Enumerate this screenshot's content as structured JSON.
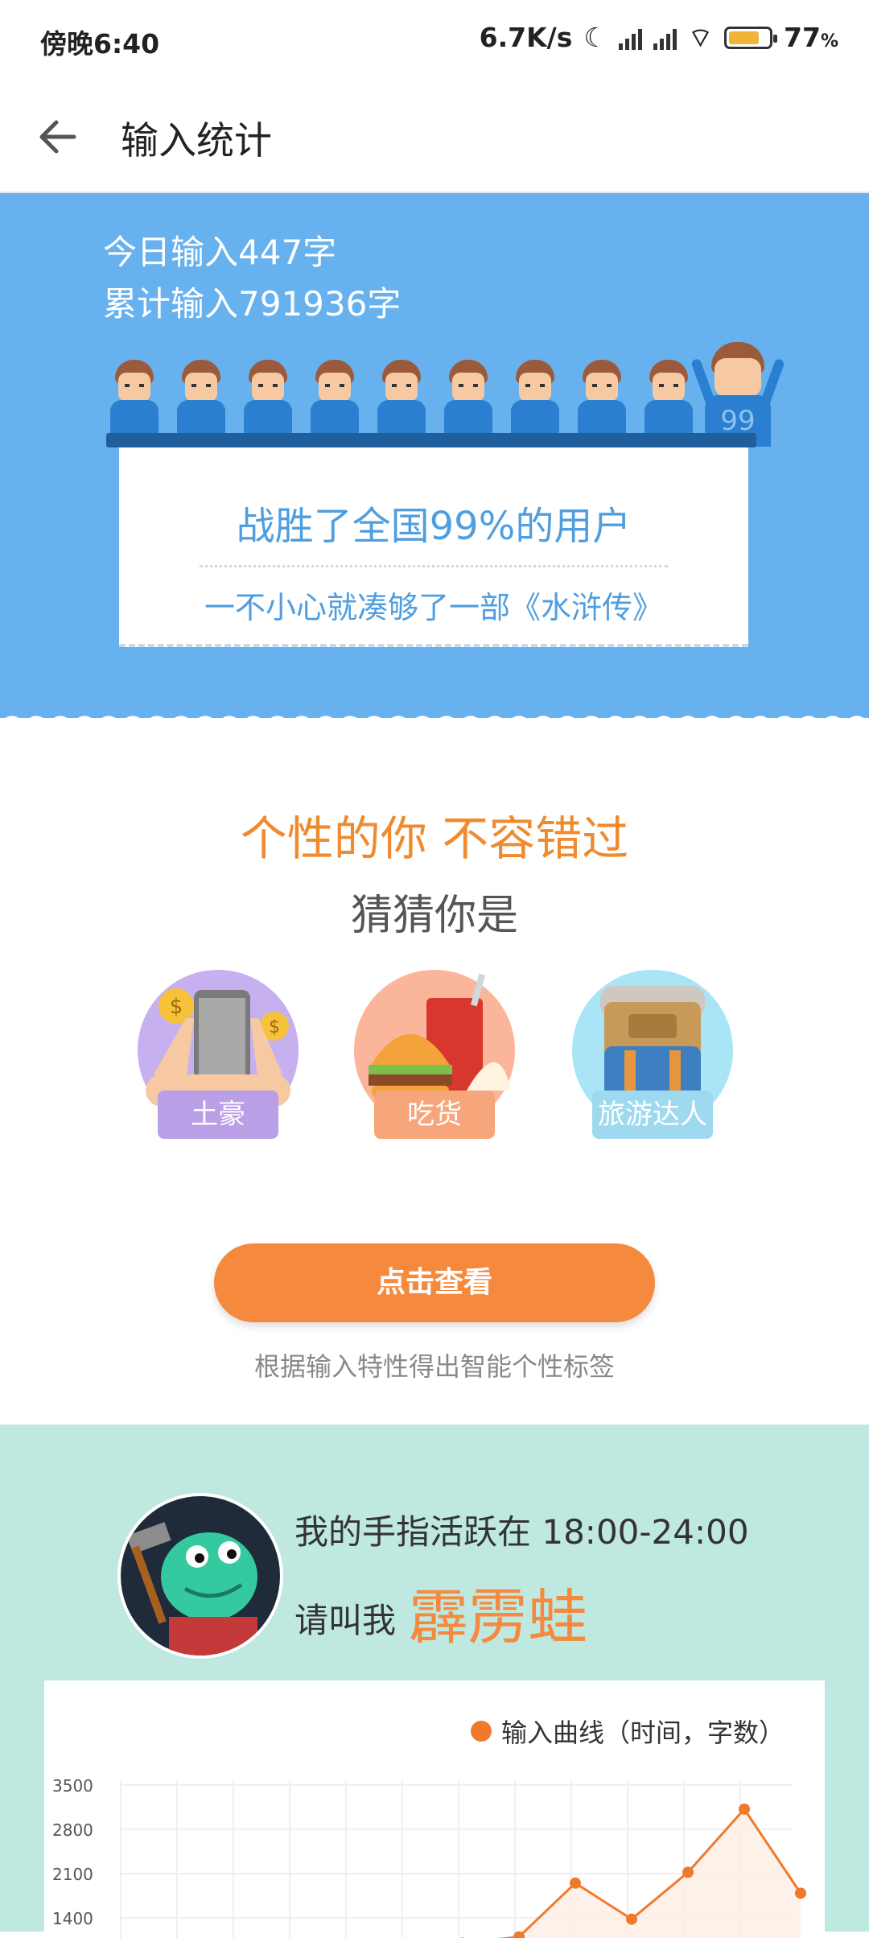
{
  "status_bar": {
    "time": "傍晚6:40",
    "net_speed": "6.7K/s",
    "battery_percent": "77",
    "battery_unit": "%",
    "battery_level": 0.77
  },
  "app_bar": {
    "title": "输入统计"
  },
  "summary": {
    "today": "今日输入447字",
    "total": "累计输入791936字",
    "badge": "99",
    "rank": "战胜了全国99%的用户",
    "comparison": "一不小心就凑够了一部《水浒传》"
  },
  "personality": {
    "slogan": "个性的你 不容错过",
    "guess": "猜猜你是",
    "tags": [
      {
        "label": "土豪",
        "color": "#b9a0e6",
        "circle": "#c7b0f0"
      },
      {
        "label": "吃货",
        "color": "#f7a57a",
        "circle": "#fbb59a"
      },
      {
        "label": "旅游达人",
        "color": "#9ed9ef",
        "circle": "#a9e4f7"
      }
    ],
    "button": "点击查看",
    "hint": "根据输入特性得出智能个性标签"
  },
  "activity": {
    "active_text": "我的手指活跃在 18:00-24:00",
    "call_prefix": "请叫我",
    "nickname": "霹雳蛙"
  },
  "chart_data": {
    "type": "line",
    "legend": "输入曲线（时间，字数）",
    "y_ticks": [
      "3500",
      "2800",
      "2100",
      "1400"
    ],
    "ylim": [
      0,
      3500
    ],
    "points": [
      {
        "x": 0,
        "y": 1000
      },
      {
        "x": 1,
        "y": 1100
      },
      {
        "x": 2,
        "y": 1950
      },
      {
        "x": 3,
        "y": 1380
      },
      {
        "x": 4,
        "y": 2120
      },
      {
        "x": 5,
        "y": 3120
      },
      {
        "x": 6,
        "y": 1790
      }
    ],
    "color": "#f07a2c",
    "grid": true
  }
}
